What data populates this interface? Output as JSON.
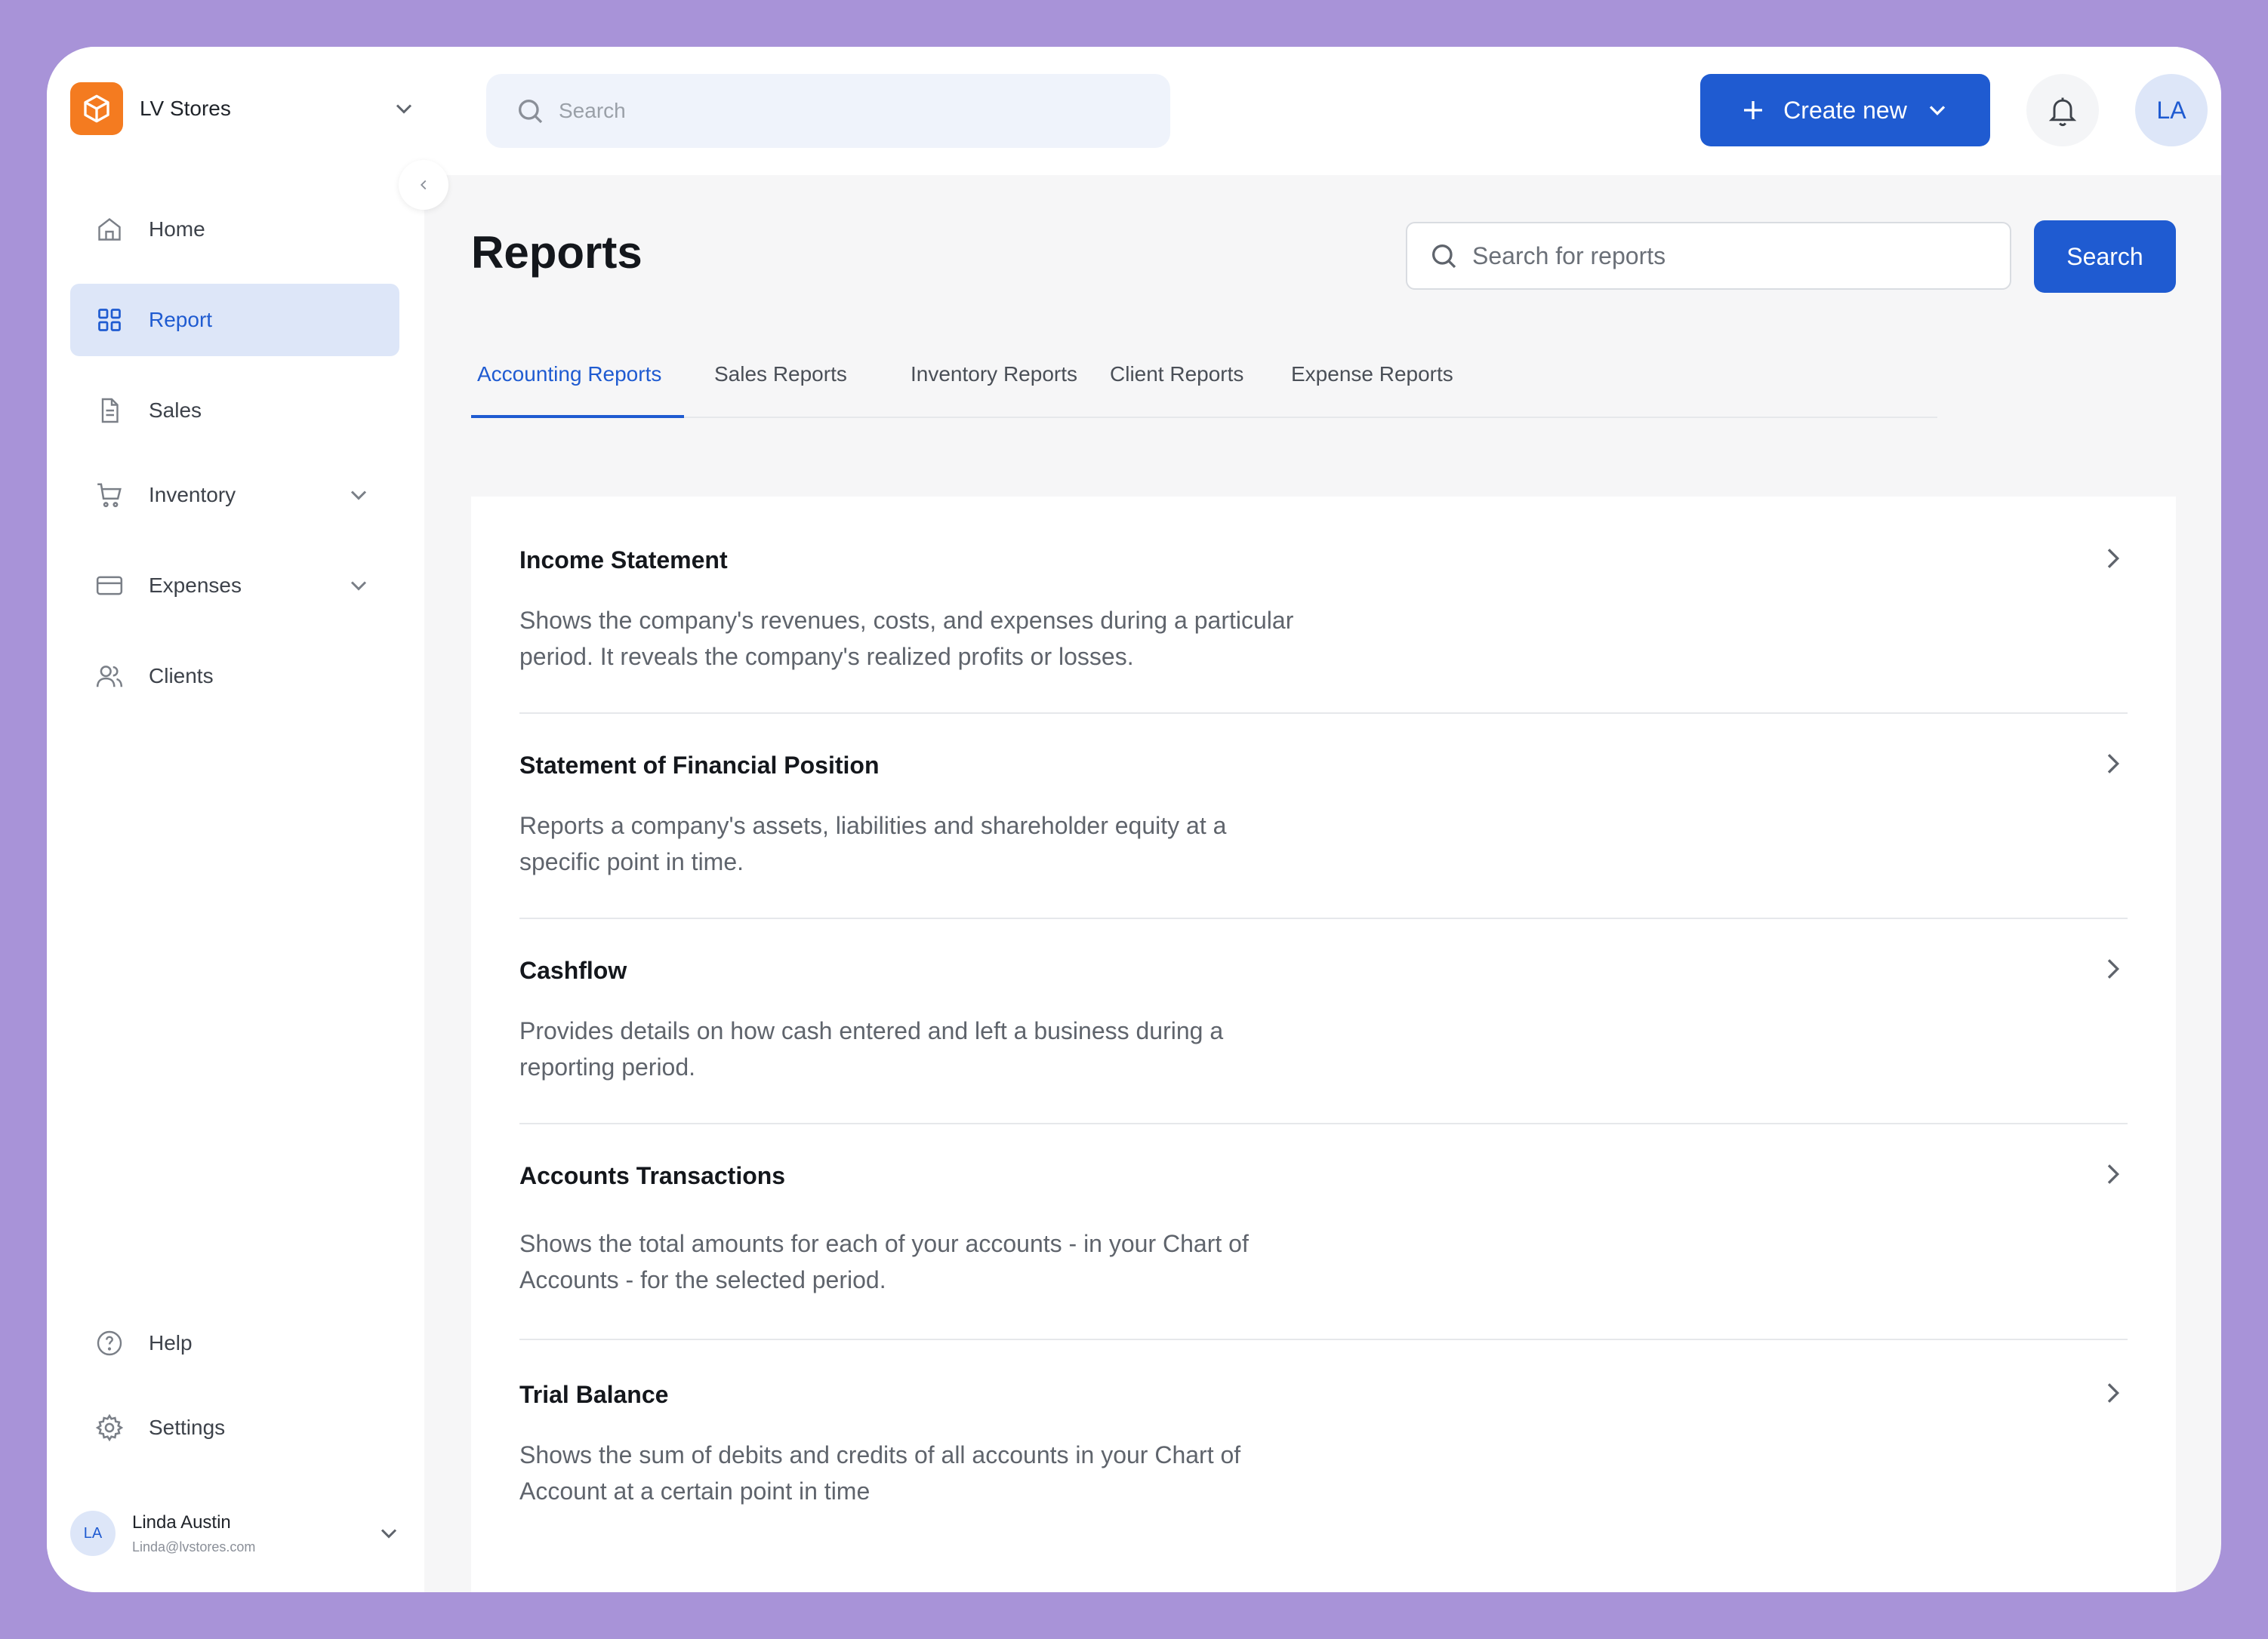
{
  "brand": {
    "name": "LV Stores",
    "icon": "box-icon",
    "color": "#f47b20"
  },
  "sidebar": {
    "items": [
      {
        "label": "Home",
        "icon": "home-icon"
      },
      {
        "label": "Report",
        "icon": "grid-icon",
        "active": true
      },
      {
        "label": "Sales",
        "icon": "document-icon"
      },
      {
        "label": "Inventory",
        "icon": "cart-icon",
        "expandable": true
      },
      {
        "label": "Expenses",
        "icon": "credit-card-icon",
        "expandable": true
      },
      {
        "label": "Clients",
        "icon": "users-icon"
      }
    ],
    "bottom": [
      {
        "label": "Help",
        "icon": "help-icon"
      },
      {
        "label": "Settings",
        "icon": "gear-icon"
      }
    ],
    "user": {
      "initials": "LA",
      "name": "Linda Austin",
      "email": "Linda@lvstores.com"
    }
  },
  "topbar": {
    "search_placeholder": "Search",
    "create_label": "Create new",
    "avatar_initials": "LA"
  },
  "main": {
    "title": "Reports",
    "search_placeholder": "Search for reports",
    "search_button": "Search",
    "tabs": [
      {
        "label": "Accounting Reports",
        "active": true
      },
      {
        "label": "Sales Reports"
      },
      {
        "label": "Inventory Reports"
      },
      {
        "label": "Client Reports"
      },
      {
        "label": "Expense Reports"
      }
    ],
    "reports": [
      {
        "title": "Income Statement",
        "description": "Shows the company's revenues, costs, and expenses during a particular period. It reveals the company's realized profits or losses."
      },
      {
        "title": "Statement of Financial Position",
        "description": "Reports a company's assets, liabilities and shareholder equity at a specific point in time."
      },
      {
        "title": "Cashflow",
        "description": "Provides details on how cash entered and left a business during a reporting period."
      },
      {
        "title": "Accounts Transactions",
        "description": "Shows the total amounts for each of your accounts - in your Chart of Accounts - for the selected period."
      },
      {
        "title": "Trial Balance",
        "description": "Shows the sum of debits and credits of all accounts in your Chart of Account at a certain point in time"
      }
    ]
  },
  "colors": {
    "accent": "#1f5bd1",
    "frame": "#a893d8",
    "active_bg": "#dde6f8"
  }
}
